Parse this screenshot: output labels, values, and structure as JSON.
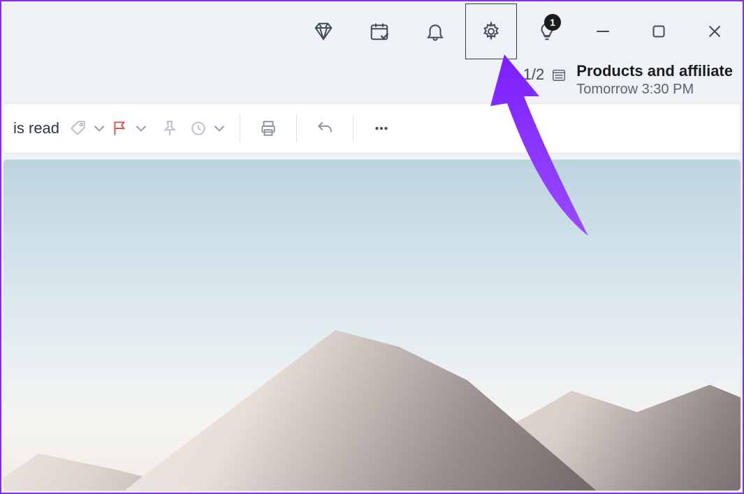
{
  "titlebar": {
    "hint_badge": "1"
  },
  "secondrow": {
    "counter": "1/2",
    "event_title": "Products and affiliate",
    "event_time": "Tomorrow 3:30 PM"
  },
  "toolbar": {
    "read_label": "is read"
  }
}
